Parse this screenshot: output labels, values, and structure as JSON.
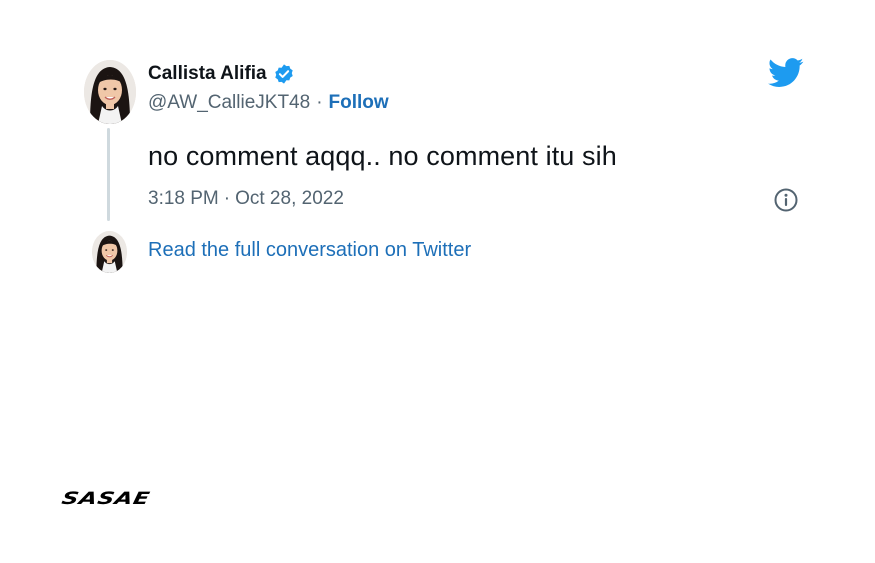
{
  "tweet": {
    "author": {
      "display_name": "Callista Alifia",
      "verified": true,
      "handle": "@AW_CallieJKT48",
      "follow_label": "Follow",
      "avatar": "avatar-photo"
    },
    "text": "no comment aqqq.. no comment itu sih",
    "time": "3:18 PM",
    "date": "Oct 28, 2022",
    "separator": "·",
    "read_more_label": "Read the full conversation on Twitter",
    "icons": {
      "platform": "twitter-bird-icon",
      "verified": "verified-badge-icon",
      "info": "info-icon"
    }
  },
  "colors": {
    "link": "#1d6fb8",
    "twitter_blue": "#1d9bf0",
    "text_primary": "#0f1419",
    "text_secondary": "#536471",
    "thread_line": "#cfd9de"
  },
  "footer": {
    "brand": "SASAE"
  }
}
